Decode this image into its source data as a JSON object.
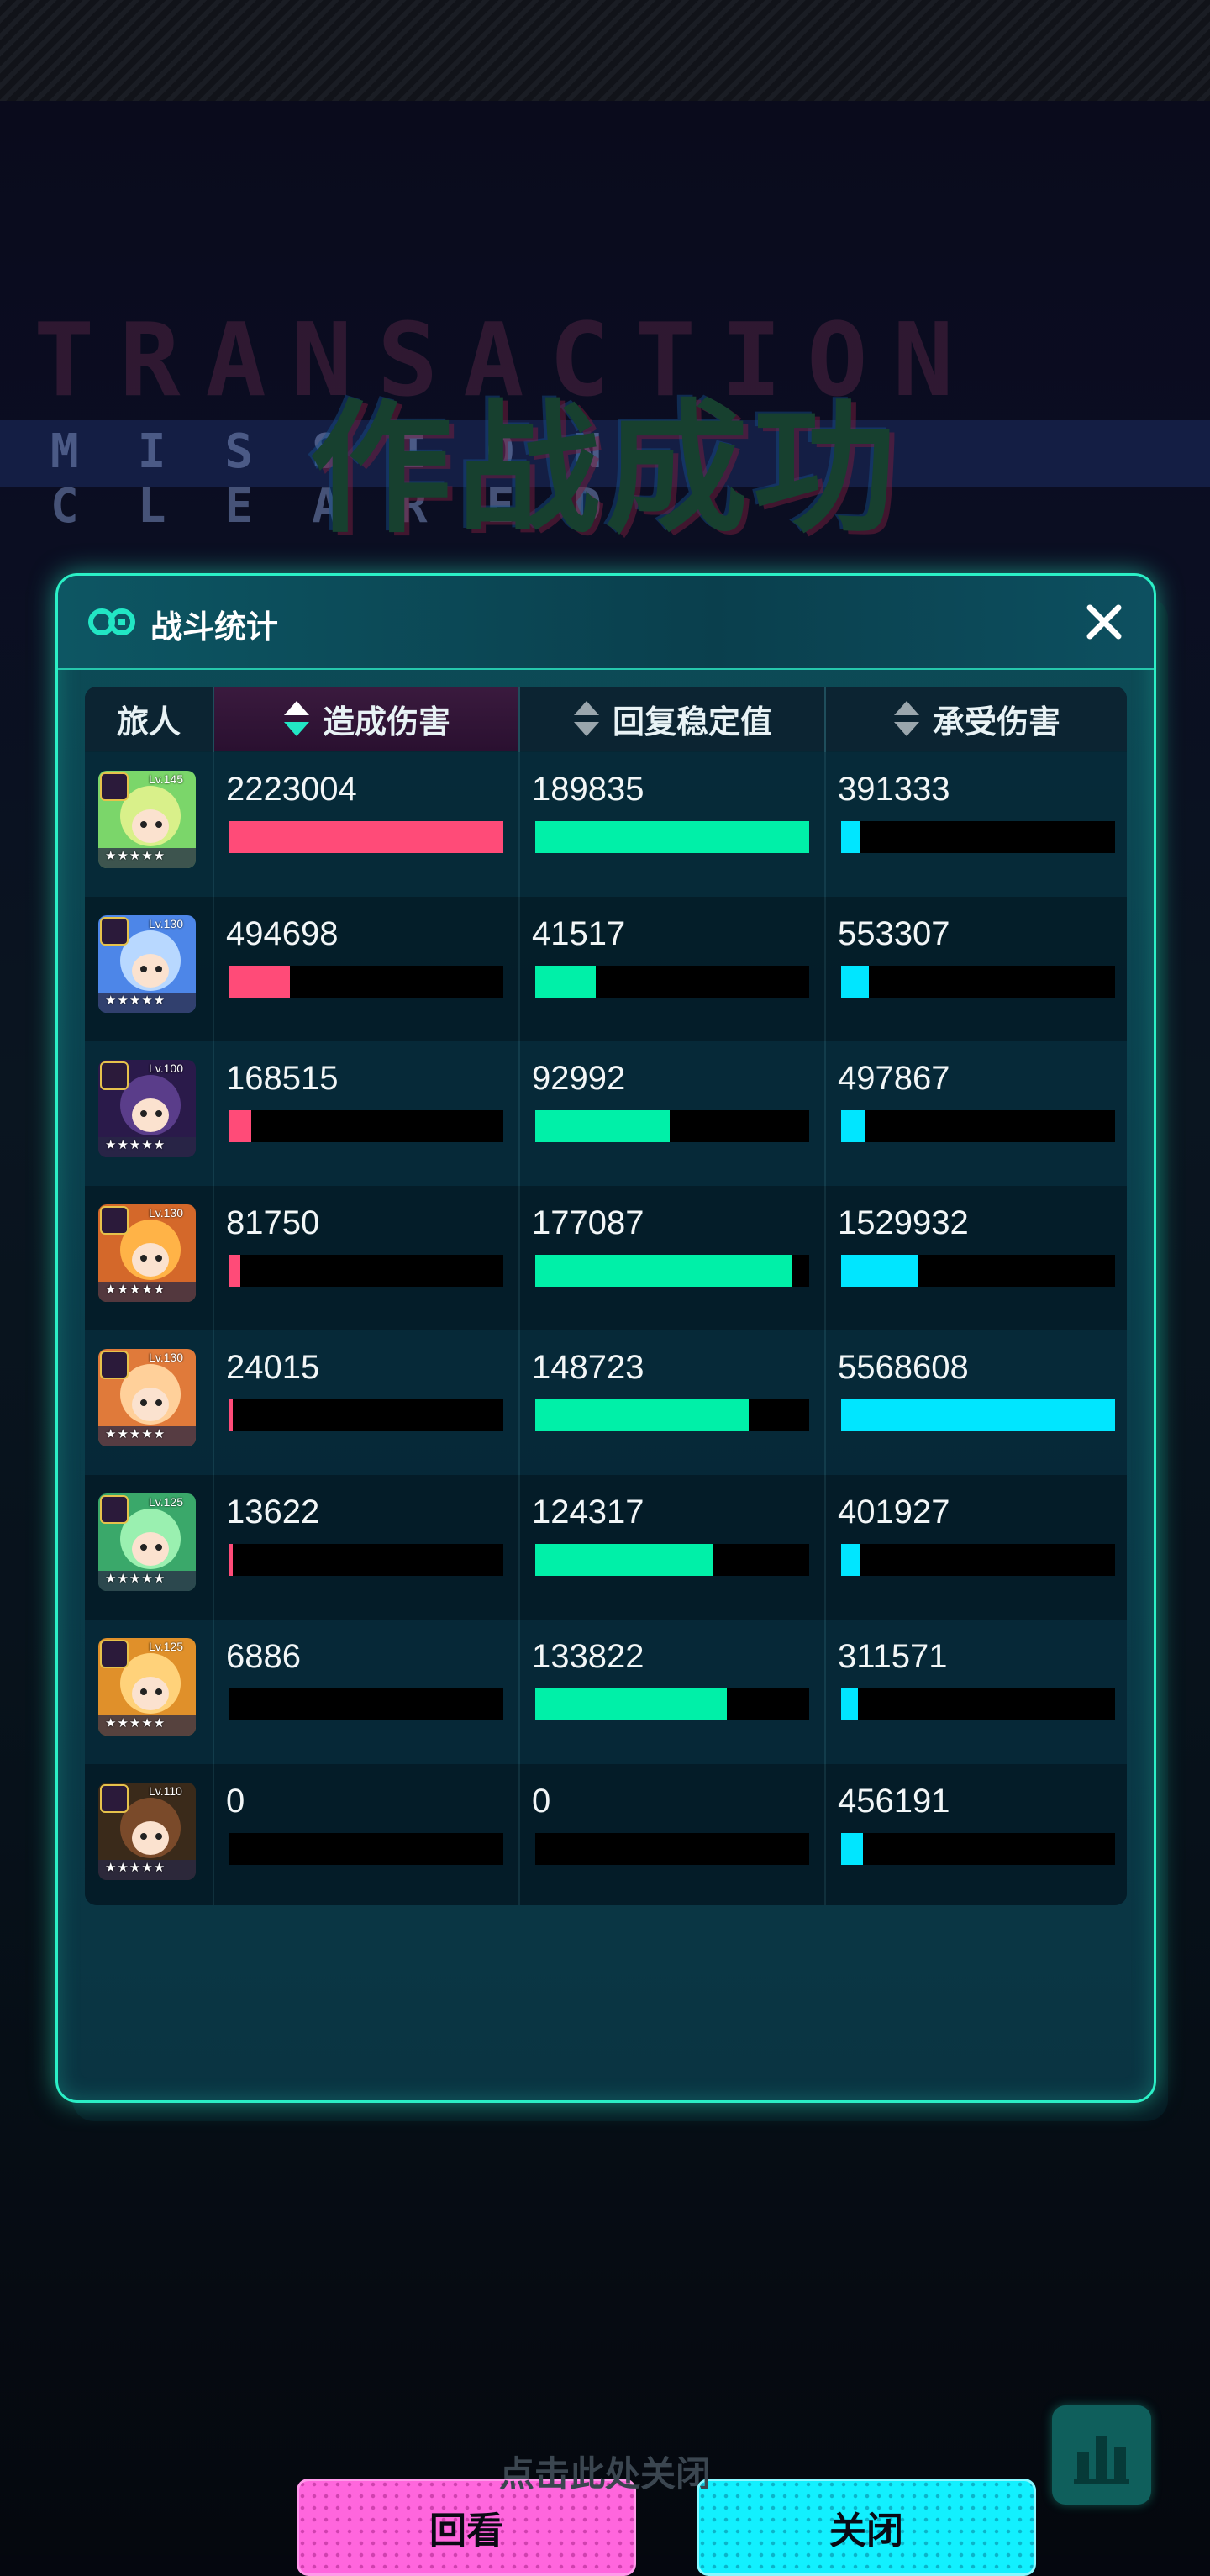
{
  "background": {
    "title_cn": "作战成功",
    "title_en": "TRANSACTION",
    "band_text": "MISSION CLEARED"
  },
  "panel": {
    "title": "战斗统计",
    "close_icon": "close-icon",
    "header_icon": "battle-stats-icon"
  },
  "table": {
    "headers": [
      "旅人",
      "造成伤害",
      "回复稳定值",
      "承受伤害"
    ],
    "active_sort_column": 1,
    "colors": {
      "damage": "#ff4b78",
      "heal": "#00f0a8",
      "taken": "#00e6ff"
    },
    "rows": [
      {
        "level": "Lv.145",
        "stars": "★★★★★",
        "portrait": "green-hair-traveler",
        "damage": "2223004",
        "heal": "189835",
        "taken": "391333",
        "damage_pct": 100,
        "heal_pct": 100,
        "taken_pct": 7
      },
      {
        "level": "Lv.130",
        "stars": "★★★★★",
        "portrait": "blue-hair-traveler",
        "damage": "494698",
        "heal": "41517",
        "taken": "553307",
        "damage_pct": 22,
        "heal_pct": 22,
        "taken_pct": 10
      },
      {
        "level": "Lv.100",
        "stars": "★★★★★",
        "portrait": "purple-hair-traveler",
        "damage": "168515",
        "heal": "92992",
        "taken": "497867",
        "damage_pct": 8,
        "heal_pct": 49,
        "taken_pct": 9
      },
      {
        "level": "Lv.130",
        "stars": "★★★★★",
        "portrait": "orange-masked-traveler",
        "damage": "81750",
        "heal": "177087",
        "taken": "1529932",
        "damage_pct": 4,
        "heal_pct": 94,
        "taken_pct": 28
      },
      {
        "level": "Lv.130",
        "stars": "★★★★★",
        "portrait": "white-hat-traveler",
        "damage": "24015",
        "heal": "148723",
        "taken": "5568608",
        "damage_pct": 1,
        "heal_pct": 78,
        "taken_pct": 100
      },
      {
        "level": "Lv.125",
        "stars": "★★★★★",
        "portrait": "green-girl-traveler",
        "damage": "13622",
        "heal": "124317",
        "taken": "401927",
        "damage_pct": 1,
        "heal_pct": 65,
        "taken_pct": 7
      },
      {
        "level": "Lv.125",
        "stars": "★★★★★",
        "portrait": "yellow-hat-traveler",
        "damage": "6886",
        "heal": "133822",
        "taken": "311571",
        "damage_pct": 0,
        "heal_pct": 70,
        "taken_pct": 6
      },
      {
        "level": "Lv.110",
        "stars": "★★★★★",
        "portrait": "robot-box-traveler",
        "damage": "0",
        "heal": "0",
        "taken": "456191",
        "damage_pct": 0,
        "heal_pct": 0,
        "taken_pct": 8
      }
    ]
  },
  "buttons": {
    "replay": "回看",
    "close": "关闭"
  },
  "footer": {
    "hint": "点击此处关闭",
    "stats_icon": "bar-chart-icon"
  }
}
